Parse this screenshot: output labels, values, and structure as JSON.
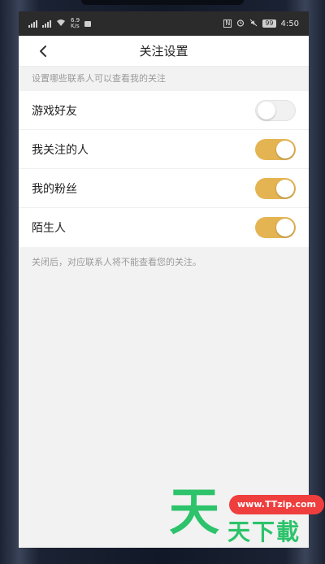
{
  "status_bar": {
    "network_speed": "6.9\nK/s",
    "battery": "99",
    "time": "4:50"
  },
  "header": {
    "title": "关注设置",
    "back_icon": "chevron-left-icon"
  },
  "section_hint": "设置哪些联系人可以查看我的关注",
  "settings": [
    {
      "label": "游戏好友",
      "enabled": false
    },
    {
      "label": "我关注的人",
      "enabled": true
    },
    {
      "label": "我的粉丝",
      "enabled": true
    },
    {
      "label": "陌生人",
      "enabled": true
    }
  ],
  "footer_note": "关闭后，对应联系人将不能查看您的关注。",
  "colors": {
    "toggle_on": "#e4b452",
    "toggle_off": "#f1f1f1"
  },
  "watermark": {
    "big_char": "天",
    "url": "www.TTzip.com",
    "text": "天下載"
  }
}
